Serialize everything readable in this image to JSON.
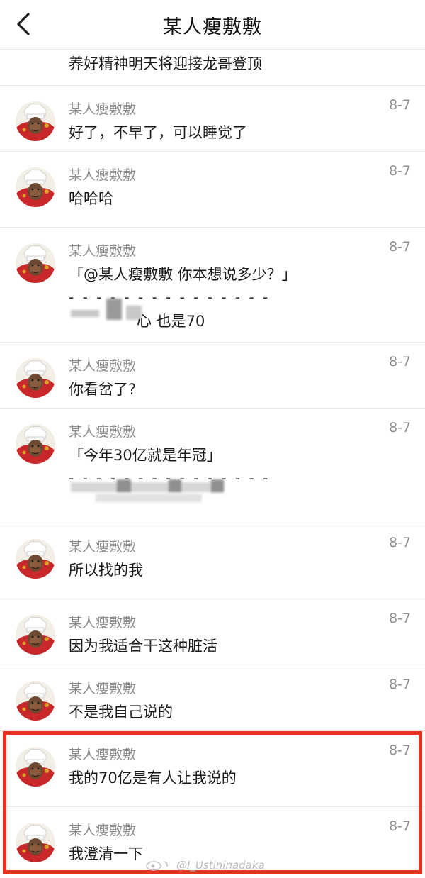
{
  "header": {
    "title": "某人瘦敷敷"
  },
  "messages": [
    {
      "sender": "",
      "date": "",
      "text": "养好精神明天将迎接龙哥登顶"
    },
    {
      "sender": "某人瘦敷敷",
      "date": "8-7",
      "text": "好了，不早了，可以睡觉了"
    },
    {
      "sender": "某人瘦敷敷",
      "date": "8-7",
      "text": "哈哈哈"
    },
    {
      "sender": "某人瘦敷敷",
      "date": "8-7",
      "quote": "「@某人瘦敷敷 你本想说多少？」",
      "divider": "- - - - - - - - - - - - - - -",
      "reply": "心 也是70"
    },
    {
      "sender": "某人瘦敷敷",
      "date": "8-7",
      "text": "你看岔了?"
    },
    {
      "sender": "某人瘦敷敷",
      "date": "8-7",
      "quote": "「今年30亿就是年冠」",
      "divider": "- - - - - - - - - - - - - - -"
    },
    {
      "sender": "某人瘦敷敷",
      "date": "8-7",
      "text": "所以找的我"
    },
    {
      "sender": "某人瘦敷敷",
      "date": "8-7",
      "text": "因为我适合干这种脏活"
    },
    {
      "sender": "某人瘦敷敷",
      "date": "8-7",
      "text": "不是我自己说的"
    },
    {
      "sender": "某人瘦敷敷",
      "date": "8-7",
      "text": "我的70亿是有人让我说的"
    },
    {
      "sender": "某人瘦敷敷",
      "date": "8-7",
      "text": "我澄清一下"
    }
  ],
  "watermark": {
    "text": "@I_Ustininadaka"
  },
  "colors": {
    "highlight": "#e8331c",
    "meta_text": "#8e8e8e"
  }
}
